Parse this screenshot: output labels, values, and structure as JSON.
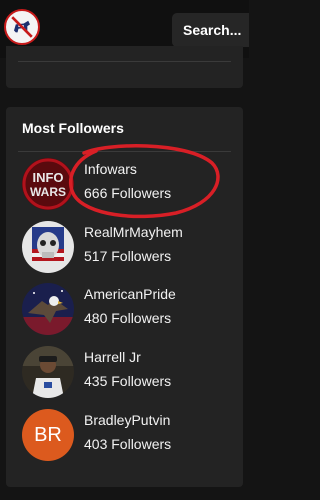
{
  "header": {
    "search_label": "Search..."
  },
  "panel": {
    "title": "Most Followers",
    "items": [
      {
        "name": "Infowars",
        "followers": "666 Followers",
        "avatar": "infowars-logo"
      },
      {
        "name": "RealMrMayhem",
        "followers": "517 Followers",
        "avatar": "skull-flag-image"
      },
      {
        "name": "AmericanPride",
        "followers": "480 Followers",
        "avatar": "eagle-image"
      },
      {
        "name": "Harrell Jr",
        "followers": "435 Followers",
        "avatar": "person-photo"
      },
      {
        "name": "BradleyPutvin",
        "followers": "403 Followers",
        "avatar_initials": "BR"
      }
    ]
  },
  "colors": {
    "annotation_circle": "#d81f26",
    "initials_avatar": "#dc5a1e"
  }
}
